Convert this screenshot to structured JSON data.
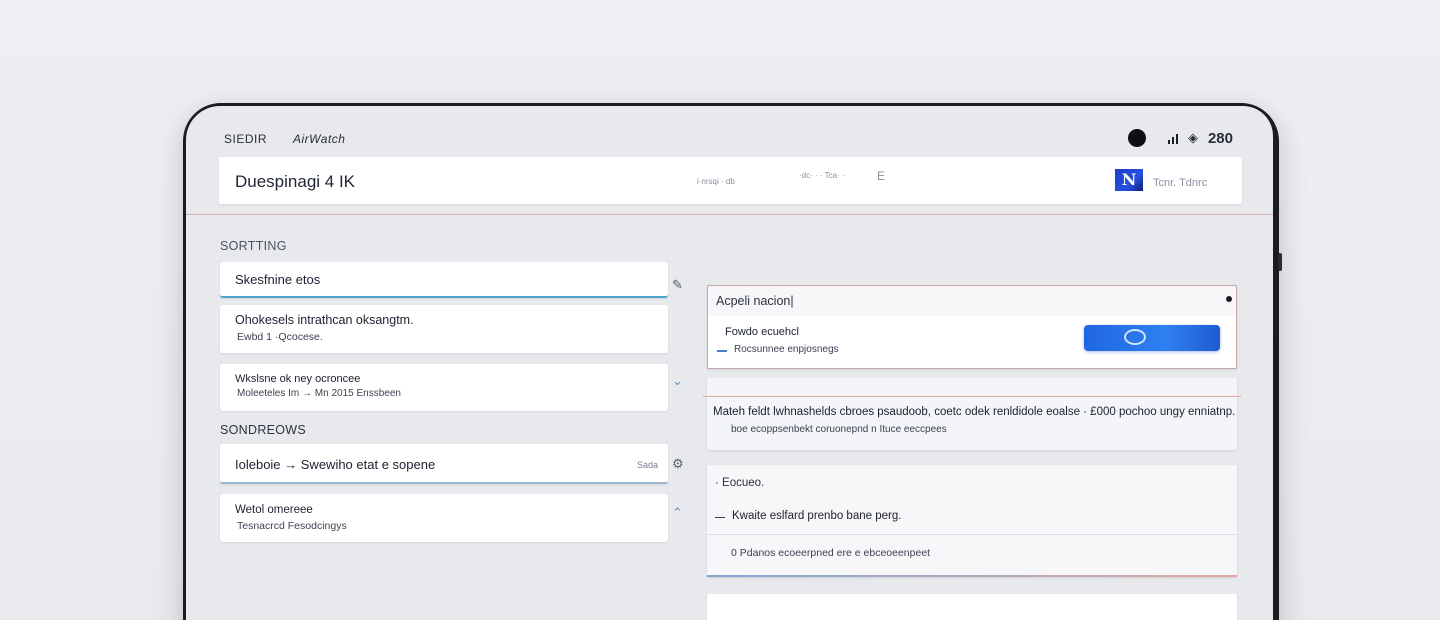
{
  "status": {
    "left_label": "SIEDIR",
    "brand": "AirWatch",
    "time": "280"
  },
  "appbar": {
    "title": "Duespinagi 4 IK",
    "hint1": "i·nrsqi · db",
    "hint2": "·dc· · · Tca· ·",
    "hint3": "E",
    "logo": "N",
    "account": "Tcnr. Tdnrc"
  },
  "left": {
    "section1_title": "SORTTING",
    "card1": {
      "title": "Skesfnine etos"
    },
    "card2": {
      "title": "Ohokesels intrathcan oksangtm.",
      "subtitle": "Ewbd 1 ·Qcocese."
    },
    "card3": {
      "title": "Wkslsne ok ney ocroncee",
      "subtitle": "Moleeteles Im → Mn 2015 Enssbeen"
    },
    "section2_title": "SONDREOWS",
    "card4": {
      "title": "Ioleboie → Swewiho etat e sopene",
      "badge": "Sada"
    },
    "card5": {
      "title": "Wetol omereee",
      "subtitle": "Tesnacrcd Fesodcingys"
    }
  },
  "right": {
    "panel1": {
      "header": "Acpeli nacion|",
      "row_title": "Fowdo ecuehcl",
      "row_sub": "Rocsunnee enpjosnegs"
    },
    "panel2": {
      "text": "Mateh feldt lwhnashelds cbroes psaudoob, coetc odek renldidole eoalse · £000 pochoo ungy enniatnp.",
      "sub": "boe ecoppsenbekt coruonepnd n Ituce eeccpees"
    },
    "panel3": {
      "head": "· Eocueo.",
      "row": "Kwaite eslfard prenbo bane perg.",
      "foot": "0 Pdanos ecoeerpned ere e ebceoeenpeet"
    }
  }
}
